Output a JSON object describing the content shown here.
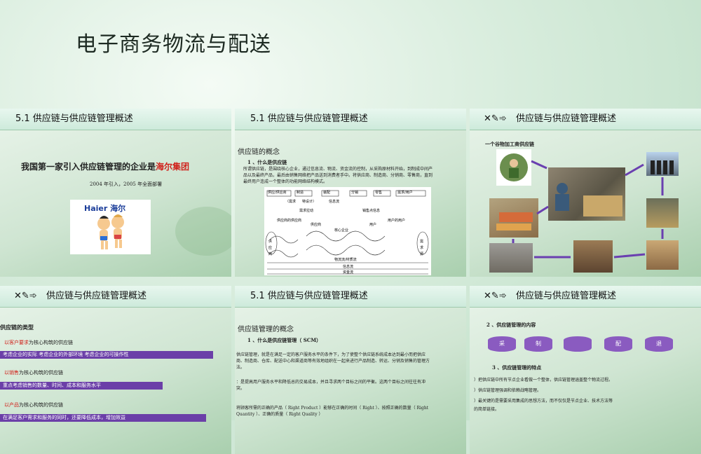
{
  "main_title": "电子商务物流与配送",
  "slides": [
    {
      "header": "5.1  供应链与供应链管理概述",
      "headline_prefix": "我国第一家引入供应链管理的企业是",
      "headline_brand": "海尔集团",
      "subtext": "2004 年引入，2005 年全面部署",
      "logo_text": "Haier 海尔"
    },
    {
      "header": "5.1  供应链与供应链管理概述",
      "section": "供应链的概念",
      "subhead": "1 、什么是供应链",
      "body": "所谓供应链，是围绕核心企业，通过信息流、物流、资金流的控制，从采购原材料开始，到制成中间产品以及最终产品，最后由销售网络把产品送到消费者手中。将供应商、制造商、分销商、零售商，直到最终用户连成一个整体的功能网络结构模式。",
      "flow_nodes": [
        "供应/供应商",
        "制造",
        "装配",
        "分销",
        "零售",
        "需求/用户"
      ],
      "flow_labels": [
        "（需求",
        "特设计）",
        "信息流",
        "需求拉动",
        "销售点信息",
        "供应商的供应商",
        "供应商",
        "核心企业",
        "用户",
        "用户的用户",
        "供应商",
        "需求源"
      ],
      "bottom_flows": [
        "物流流/材质流",
        "信息流",
        "资金流"
      ]
    },
    {
      "header": "供应链与供应链管理概述",
      "header_glyphs": "✕✎➾",
      "caption": "一个谷物加工商供应链"
    },
    {
      "header": "供应链与供应链管理概述",
      "header_glyphs": "✕✎➾",
      "section": "供应链的类型",
      "items": [
        {
          "label": "以客户要求为核心构筑的供应链",
          "bar": "考虑企业的实际      考虑企业的外部环境      考虑企业的可操作性"
        },
        {
          "label": "以销售为核心构筑的供应链",
          "bar": "重点考虑销售的数量、时间、成本和服务水平"
        },
        {
          "label": "以产品为核心构筑的供应链",
          "bar": "在满足客户需求和服务的同时，还要降低成本，增加效益"
        }
      ]
    },
    {
      "header": "5.1  供应链与供应链管理概述",
      "section": "供应链管理的概念",
      "subhead": "1 、什么是供应链管理（ SCM）",
      "p1": "供应链管理，就是在满足一定的客户服务水平的条件下，为了使整个供应链系统成本达到最小而把供应商、制造商、仓库、配送中心和渠道商等有效地组织在一起来进行产品制造、转运、分销及销售的管理方法。",
      "p2": "：是提高用户服务水平和降低总的交易成本，并且寻求两个目标之间的平衡。这两个目标之间往往有冲突。",
      "p3": "将顾客所需的正确的产品（ Right Product ）能够在正确的时间（ Right ）、按照正确的数量（ Right Quantity ）、正确的质量（ Right Quality ）"
    },
    {
      "header": "供应链与供应链管理概述",
      "header_glyphs": "✕✎➾",
      "subhead1": "2 、供应链管理的内容",
      "cylinders": [
        "采",
        "制",
        "",
        "配",
        "退"
      ],
      "subhead2": "3 、供应链管理的特点",
      "points": [
        "）把供应链中所有节点企业看做一个整体，供应链管理涵盖整个物流过程。",
        "）供应链管理强调和依赖战略管理。",
        "）最关键的是需要采用集成的思想方法，而不仅仅是节点企业、技术方法等",
        "的简单链接。"
      ]
    }
  ]
}
